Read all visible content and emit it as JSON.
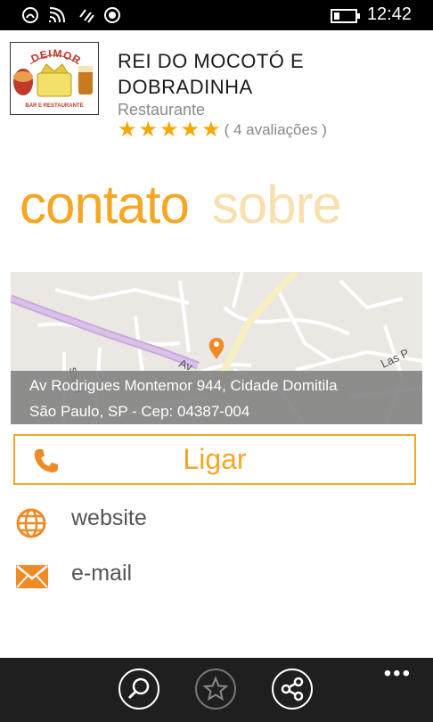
{
  "status_bar": {
    "time": "12:42"
  },
  "header": {
    "logo_text": "DEIMOR",
    "logo_subtext": "BAR E RESTAURANTE",
    "title": "REI DO MOCOTÓ E DOBRADINHA",
    "category": "Restaurante",
    "rating": 5,
    "reviews": "( 4 avaliações )"
  },
  "pivot": {
    "tabs": [
      "contato",
      "sobre"
    ],
    "active_index": 0
  },
  "map": {
    "street_labels": [
      "ssaki",
      "Av",
      "Las P"
    ],
    "address_line1": "Av Rodrigues Montemor 944, Cidade Domitila",
    "address_line2": "São Paulo, SP - Cep: 04387-004"
  },
  "actions": {
    "call_label": "Ligar",
    "website_label": "website",
    "email_label": "e-mail"
  },
  "app_bar": {
    "buttons": [
      "search-icon",
      "favorite-star-icon",
      "share-icon"
    ],
    "more": "•••"
  },
  "colors": {
    "accent": "#f5a623",
    "accent_light": "#f9dfae",
    "app_bar": "#1f1f1f"
  }
}
